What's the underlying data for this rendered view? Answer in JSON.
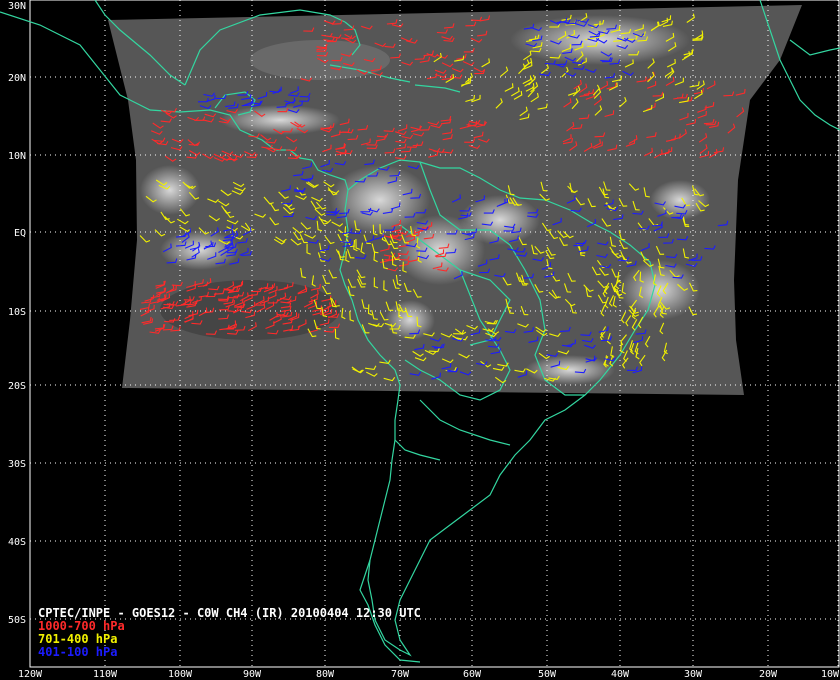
{
  "map": {
    "title": "CPTEC/INPE - GOES12 - C0W CH4 (IR) 20100404 12:30 UTC",
    "lat_labels": [
      "30N",
      "20N",
      "10N",
      "EQ",
      "10S",
      "20S",
      "30S",
      "40S",
      "50S"
    ],
    "lon_labels": [
      "120W",
      "110W",
      "100W",
      "90W",
      "80W",
      "70W",
      "60W",
      "50W",
      "40W",
      "30W",
      "20W",
      "10W"
    ],
    "legend": [
      {
        "label": "1000-700 hPa",
        "color": "#ff2a2a"
      },
      {
        "label": "701-400 hPa",
        "color": "#f2f200"
      },
      {
        "label": "401-100 hPa",
        "color": "#1c1cff"
      }
    ],
    "colors": {
      "background": "#000000",
      "coastline": "#33d6a0",
      "grid": "#ffffff",
      "imagery": "#5a5a5a"
    }
  }
}
